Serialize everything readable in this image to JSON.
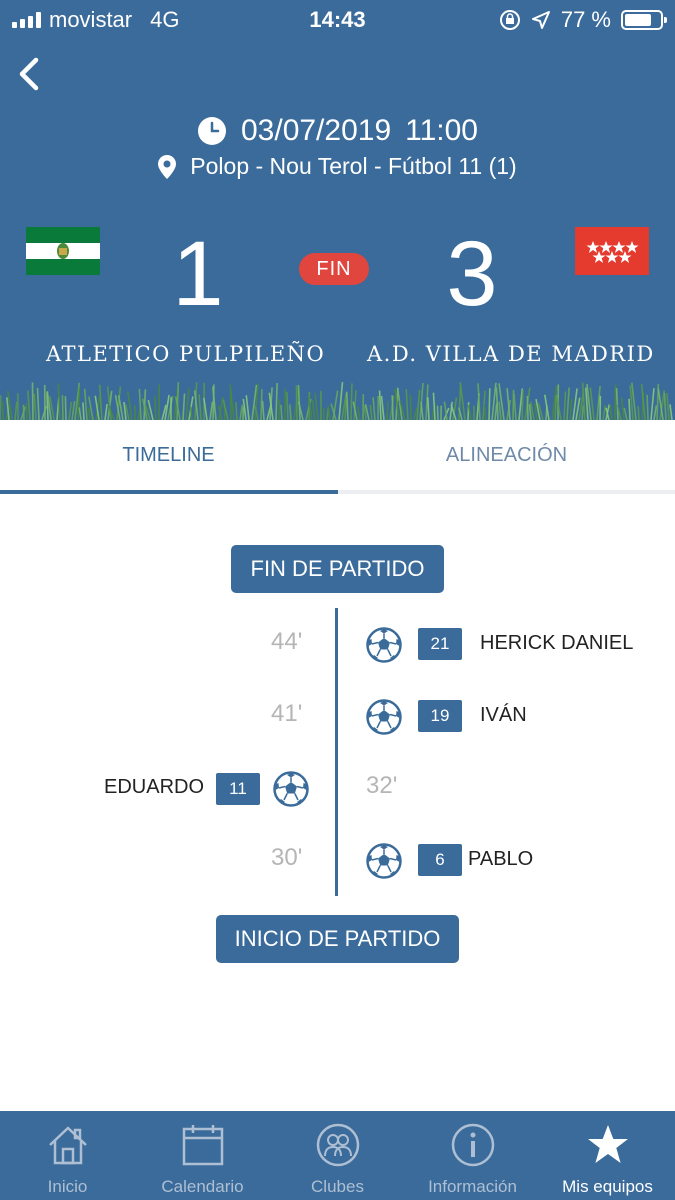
{
  "status_bar": {
    "carrier": "movistar",
    "network": "4G",
    "time": "14:43",
    "battery_label": "77 %",
    "battery_level": 0.77
  },
  "match": {
    "date": "03/07/2019",
    "time": "11:00",
    "location": "Polop - Nou Terol - Fútbol 11 (1)",
    "home_team": "ATLETICO PULPILEÑO",
    "away_team": "A.D. VILLA DE MADRID",
    "home_score": "1",
    "away_score": "3",
    "status": "FIN"
  },
  "tabs": [
    {
      "label": "TIMELINE",
      "active": true
    },
    {
      "label": "ALINEACIÓN",
      "active": false
    }
  ],
  "timeline": {
    "end_label": "FIN DE PARTIDO",
    "start_label": "INICIO DE PARTIDO",
    "events": [
      {
        "minute": "44'",
        "side": "away",
        "number": "21",
        "player": "HERICK DANIEL",
        "icon": "soccer-ball-icon"
      },
      {
        "minute": "41'",
        "side": "away",
        "number": "19",
        "player": "IVÁN",
        "icon": "soccer-ball-icon"
      },
      {
        "minute": "32'",
        "side": "home",
        "number": "11",
        "player": "EDUARDO",
        "icon": "soccer-ball-icon"
      },
      {
        "minute": "30'",
        "side": "away",
        "number": "6",
        "player": "PABLO",
        "icon": "soccer-ball-icon"
      }
    ]
  },
  "nav": [
    {
      "label": "Inicio",
      "icon": "home-icon"
    },
    {
      "label": "Calendario",
      "icon": "calendar-icon"
    },
    {
      "label": "Clubes",
      "icon": "clubs-icon"
    },
    {
      "label": "Información",
      "icon": "info-icon"
    },
    {
      "label": "Mis equipos",
      "icon": "star-icon",
      "active": true
    }
  ],
  "colors": {
    "brand": "#3a6b9a",
    "fin_badge": "#e0463e",
    "minute_text": "#b5b5b5"
  }
}
